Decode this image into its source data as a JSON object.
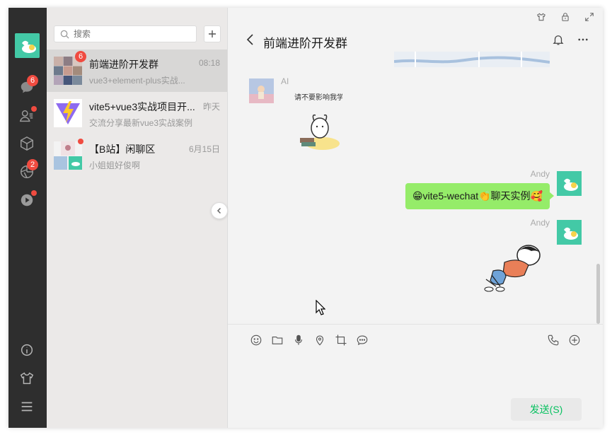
{
  "rail": {
    "items": [
      {
        "name": "chat-icon",
        "badge": "6"
      },
      {
        "name": "contacts-icon",
        "dot": true
      },
      {
        "name": "cube-icon"
      },
      {
        "name": "moments-icon",
        "badge": "2"
      },
      {
        "name": "video-icon",
        "dot": true
      }
    ],
    "bottom": [
      "info-icon",
      "theme-icon",
      "menu-icon"
    ]
  },
  "search": {
    "placeholder": "搜索"
  },
  "sessions": [
    {
      "name": "前端进阶开发群",
      "time": "08:18",
      "last": "vue3+element-plus实战...",
      "badge": "6",
      "active": true
    },
    {
      "name": "vite5+vue3实战项目开...",
      "time": "昨天",
      "last": "交流分享最新vue3实战案例"
    },
    {
      "name": "【B站】闲聊区",
      "time": "6月15日",
      "last": "小姐姐好俊啊",
      "dot": true
    }
  ],
  "chat": {
    "title": "前端进阶开发群",
    "messages": [
      {
        "nick": "AI",
        "type": "sticker",
        "sticker_text": "请不要影响我学习"
      },
      {
        "nick": "Andy",
        "type": "text",
        "text": "😁vite5-wechat👏聊天实例🥰"
      },
      {
        "nick": "Andy",
        "type": "sticker"
      }
    ]
  },
  "composer": {
    "tools": [
      "emoji-icon",
      "folder-icon",
      "mic-icon",
      "location-icon",
      "crop-icon",
      "chat-bubble-icon"
    ],
    "tools_right": [
      "phone-icon",
      "plus-circle-icon"
    ],
    "send_label": "发送(S)"
  },
  "colors": {
    "accent": "#07c160",
    "bubble": "#95ec69",
    "badge": "#f04b40",
    "rail": "#2e2e2e"
  }
}
